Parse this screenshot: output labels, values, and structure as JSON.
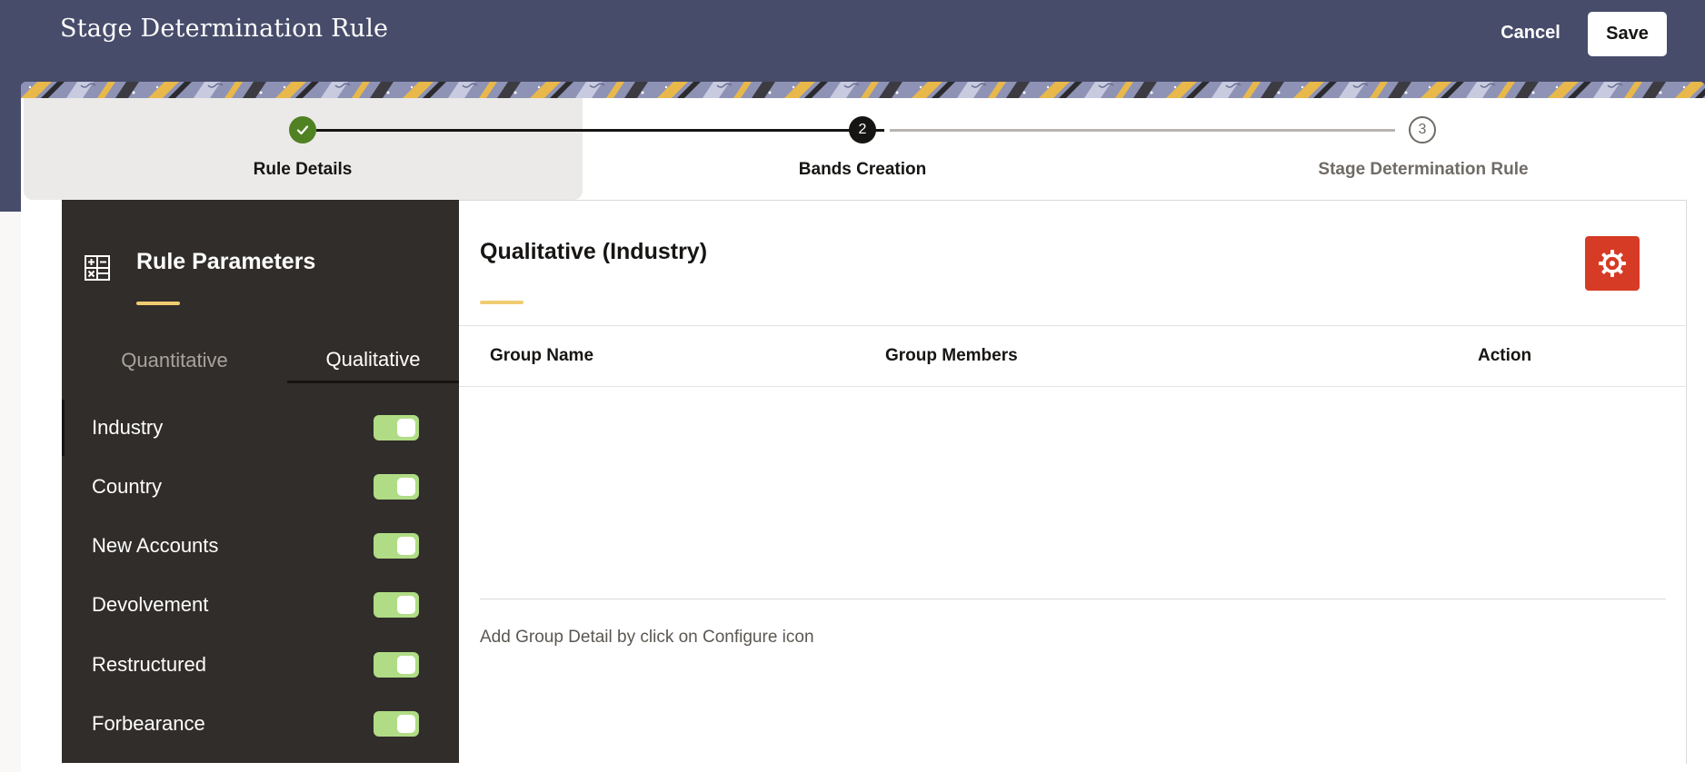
{
  "header": {
    "title": "Stage Determination Rule",
    "cancel_label": "Cancel",
    "save_label": "Save"
  },
  "stepper": {
    "steps": [
      {
        "number": "",
        "label": "Rule Details",
        "state": "completed"
      },
      {
        "number": "2",
        "label": "Bands Creation",
        "state": "current"
      },
      {
        "number": "3",
        "label": "Stage Determination Rule",
        "state": "upcoming"
      }
    ]
  },
  "sidebar": {
    "title": "Rule Parameters",
    "tabs": [
      {
        "label": "Quantitative",
        "active": false
      },
      {
        "label": "Qualitative",
        "active": true
      }
    ],
    "items": [
      {
        "label": "Industry",
        "enabled": true,
        "selected": true
      },
      {
        "label": "Country",
        "enabled": true,
        "selected": false
      },
      {
        "label": "New Accounts",
        "enabled": true,
        "selected": false
      },
      {
        "label": "Devolvement",
        "enabled": true,
        "selected": false
      },
      {
        "label": "Restructured",
        "enabled": true,
        "selected": false
      },
      {
        "label": "Forbearance",
        "enabled": true,
        "selected": false
      }
    ]
  },
  "main": {
    "title": "Qualitative (Industry)",
    "columns": [
      "Group Name",
      "Group Members",
      "Action"
    ],
    "rows": [],
    "empty_message": "Add Group Detail by click on Configure icon"
  },
  "colors": {
    "header_bg": "#474c6a",
    "sidebar_bg": "#312d2a",
    "accent_underline": "#f0cc71",
    "toggle_on": "#b0dc85",
    "configure_button": "#d63b25",
    "step_completed": "#508223"
  },
  "icons": {
    "step_completed": "check-icon",
    "sidebar_title": "table-grid-icon",
    "configure": "gear-icon"
  }
}
